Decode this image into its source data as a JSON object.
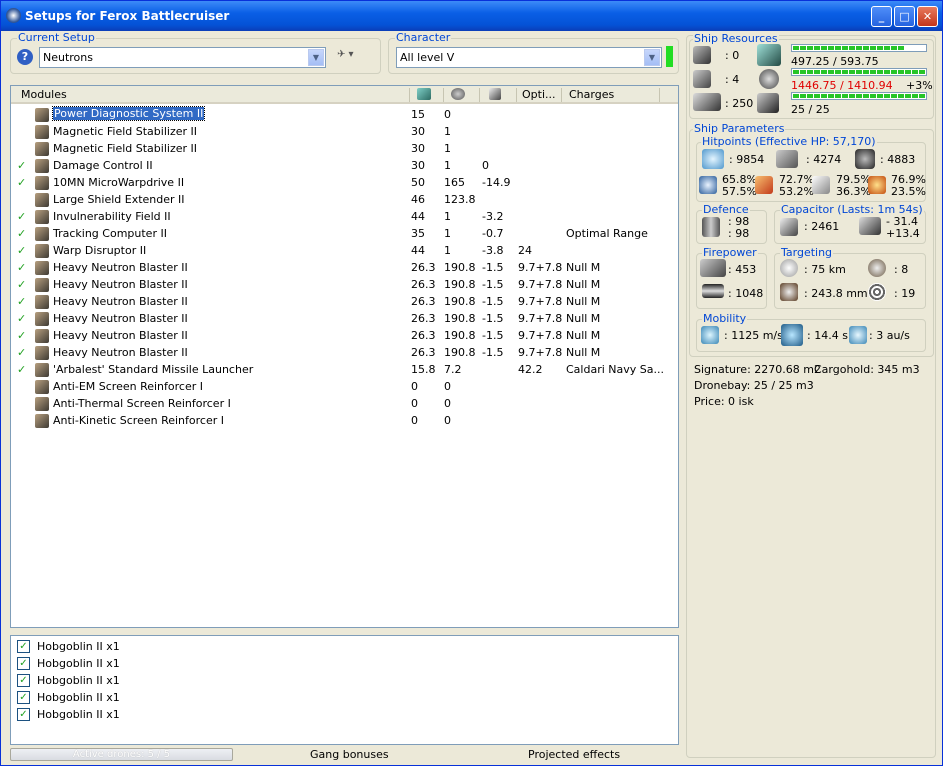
{
  "window": {
    "title": "Setups for Ferox Battlecruiser"
  },
  "current_setup": {
    "group_title": "Current Setup",
    "value": "Neutrons"
  },
  "character": {
    "group_title": "Character",
    "value": "All level V"
  },
  "modules": {
    "headers": [
      "Modules",
      "",
      "",
      "",
      "Opti...",
      "Charges"
    ],
    "rows": [
      {
        "check": "",
        "name": "Power Diagnostic System II",
        "c1": "15",
        "c2": "0",
        "c3": "",
        "c4": "",
        "charge": "",
        "selected": true
      },
      {
        "check": "",
        "name": "Magnetic Field Stabilizer II",
        "c1": "30",
        "c2": "1",
        "c3": "",
        "c4": "",
        "charge": ""
      },
      {
        "check": "",
        "name": "Magnetic Field Stabilizer II",
        "c1": "30",
        "c2": "1",
        "c3": "",
        "c4": "",
        "charge": ""
      },
      {
        "check": "✓",
        "name": "Damage Control II",
        "c1": "30",
        "c2": "1",
        "c3": "0",
        "c4": "",
        "charge": ""
      },
      {
        "check": "✓",
        "name": "10MN MicroWarpdrive II",
        "c1": "50",
        "c2": "165",
        "c3": "-14.9",
        "c4": "",
        "charge": ""
      },
      {
        "check": "",
        "name": "Large Shield Extender II",
        "c1": "46",
        "c2": "123.8",
        "c3": "",
        "c4": "",
        "charge": ""
      },
      {
        "check": "✓",
        "name": "Invulnerability Field II",
        "c1": "44",
        "c2": "1",
        "c3": "-3.2",
        "c4": "",
        "charge": ""
      },
      {
        "check": "✓",
        "name": "Tracking Computer II",
        "c1": "35",
        "c2": "1",
        "c3": "-0.7",
        "c4": "",
        "charge": "Optimal Range"
      },
      {
        "check": "✓",
        "name": "Warp Disruptor II",
        "c1": "44",
        "c2": "1",
        "c3": "-3.8",
        "c4": "24",
        "charge": ""
      },
      {
        "check": "✓",
        "name": "Heavy Neutron Blaster II",
        "c1": "26.3",
        "c2": "190.8",
        "c3": "-1.5",
        "c4": "9.7+7.8",
        "charge": "Null M"
      },
      {
        "check": "✓",
        "name": "Heavy Neutron Blaster II",
        "c1": "26.3",
        "c2": "190.8",
        "c3": "-1.5",
        "c4": "9.7+7.8",
        "charge": "Null M"
      },
      {
        "check": "✓",
        "name": "Heavy Neutron Blaster II",
        "c1": "26.3",
        "c2": "190.8",
        "c3": "-1.5",
        "c4": "9.7+7.8",
        "charge": "Null M"
      },
      {
        "check": "✓",
        "name": "Heavy Neutron Blaster II",
        "c1": "26.3",
        "c2": "190.8",
        "c3": "-1.5",
        "c4": "9.7+7.8",
        "charge": "Null M"
      },
      {
        "check": "✓",
        "name": "Heavy Neutron Blaster II",
        "c1": "26.3",
        "c2": "190.8",
        "c3": "-1.5",
        "c4": "9.7+7.8",
        "charge": "Null M"
      },
      {
        "check": "✓",
        "name": "Heavy Neutron Blaster II",
        "c1": "26.3",
        "c2": "190.8",
        "c3": "-1.5",
        "c4": "9.7+7.8",
        "charge": "Null M"
      },
      {
        "check": "✓",
        "name": "'Arbalest' Standard Missile Launcher",
        "c1": "15.8",
        "c2": "7.2",
        "c3": "",
        "c4": "42.2",
        "charge": "Caldari Navy Sa..."
      },
      {
        "check": "",
        "name": "Anti-EM Screen Reinforcer I",
        "c1": "0",
        "c2": "0",
        "c3": "",
        "c4": "",
        "charge": ""
      },
      {
        "check": "",
        "name": "Anti-Thermal Screen Reinforcer I",
        "c1": "0",
        "c2": "0",
        "c3": "",
        "c4": "",
        "charge": ""
      },
      {
        "check": "",
        "name": "Anti-Kinetic Screen Reinforcer I",
        "c1": "0",
        "c2": "0",
        "c3": "",
        "c4": "",
        "charge": ""
      }
    ]
  },
  "drones": [
    {
      "label": "Hobgoblin II x1",
      "checked": true
    },
    {
      "label": "Hobgoblin II x1",
      "checked": true
    },
    {
      "label": "Hobgoblin II x1",
      "checked": true
    },
    {
      "label": "Hobgoblin II x1",
      "checked": true
    },
    {
      "label": "Hobgoblin II x1",
      "checked": true
    }
  ],
  "footer": {
    "active_drones": "Active drones: 5 / 5",
    "gang": "Gang bonuses",
    "projected": "Projected effects"
  },
  "resources": {
    "title": "Ship Resources",
    "hardpoints": [
      ": 0",
      ": 4",
      ": 250"
    ],
    "cpu": "497.25 / 593.75",
    "cpu_fill": 0.84,
    "power": "1446.75 / 1410.94",
    "power_extra": "+3%",
    "power_fill": 1.0,
    "drone": "25 / 25",
    "drone_fill": 1.0
  },
  "parameters": {
    "title": "Ship Parameters",
    "hitpoints_title": "Hitpoints (Effective HP: 57,170)",
    "hp": [
      ": 9854",
      ": 4274",
      ": 4883"
    ],
    "resists": [
      [
        "65.8%",
        "57.5%"
      ],
      [
        "72.7%",
        "53.2%"
      ],
      [
        "79.5%",
        "36.3%"
      ],
      [
        "76.9%",
        "23.5%"
      ]
    ],
    "defence_title": "Defence",
    "defence": [
      ": 98",
      ": 98"
    ],
    "capacitor_title": "Capacitor (Lasts: 1m 54s)",
    "capacitor": ": 2461",
    "cap_delta": [
      "- 31.4",
      "+13.4"
    ],
    "firepower_title": "Firepower",
    "firepower": [
      ": 453",
      ": 1048"
    ],
    "targeting_title": "Targeting",
    "targeting": [
      ": 75 km",
      ": 8",
      ": 243.8 mm",
      ": 19"
    ],
    "mobility_title": "Mobility",
    "mobility": [
      ": 1125 m/s",
      ": 14.4 s",
      ": 3 au/s"
    ],
    "signature": "Signature: 2270.68 m2",
    "cargohold": "Cargohold: 345 m3",
    "dronebay": "Dronebay: 25 / 25 m3",
    "price": "Price: 0 isk"
  },
  "colors": {
    "title_blue": "#0a5fe6",
    "group_title": "#0046d5",
    "bar_green": "#27c527",
    "overload_red": "#e00000"
  }
}
